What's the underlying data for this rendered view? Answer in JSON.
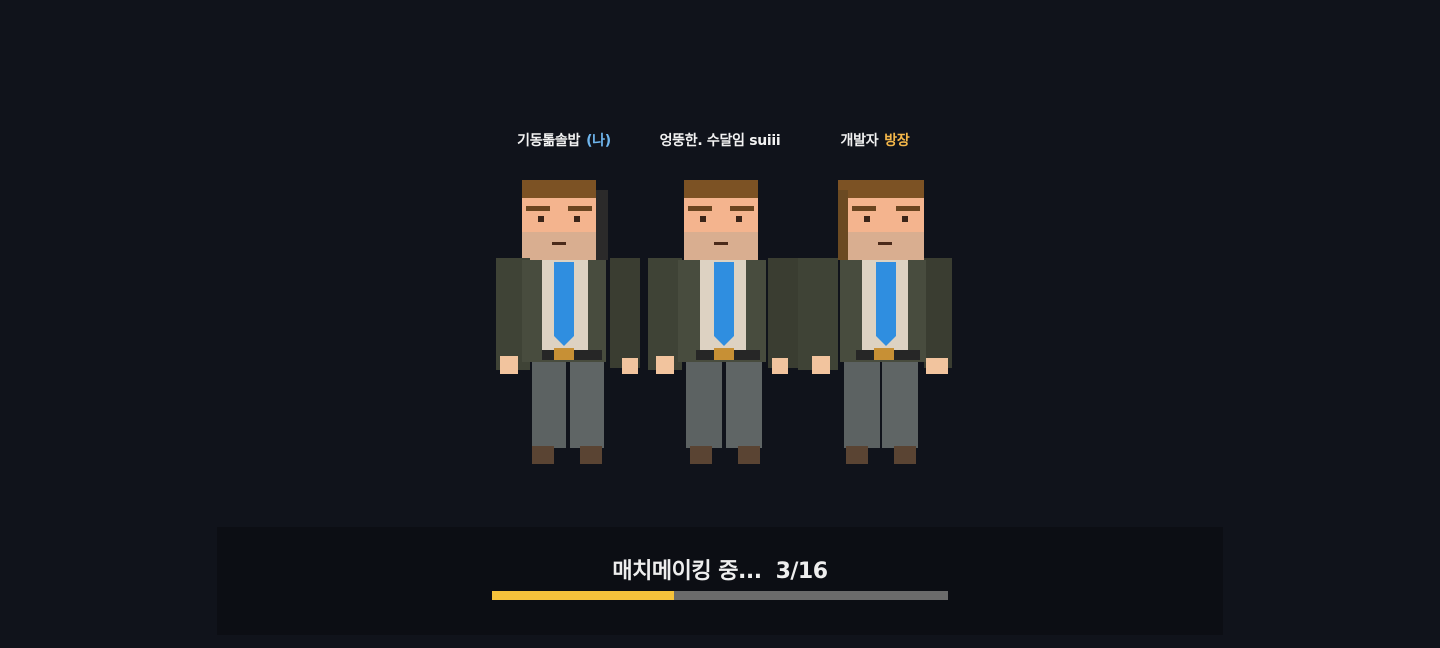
{
  "players": [
    {
      "name": "기동톪솔밥",
      "tag": "(나)",
      "tag_type": "me"
    },
    {
      "name": "엉뚱한. 수달임 suiii",
      "tag": "",
      "tag_type": ""
    },
    {
      "name": "개발자",
      "tag": "방장",
      "tag_type": "host"
    }
  ],
  "matchmaking": {
    "status_text": "매치메이킹 중...",
    "count_text": "3/16",
    "progress": 0.4
  },
  "colors": {
    "background": "#10131b",
    "panel": "#0c0e14",
    "progress_fill": "#f6c23b",
    "progress_track": "#6b6b6b",
    "tag_me": "#6fb6ee",
    "tag_host": "#f5b84a"
  }
}
